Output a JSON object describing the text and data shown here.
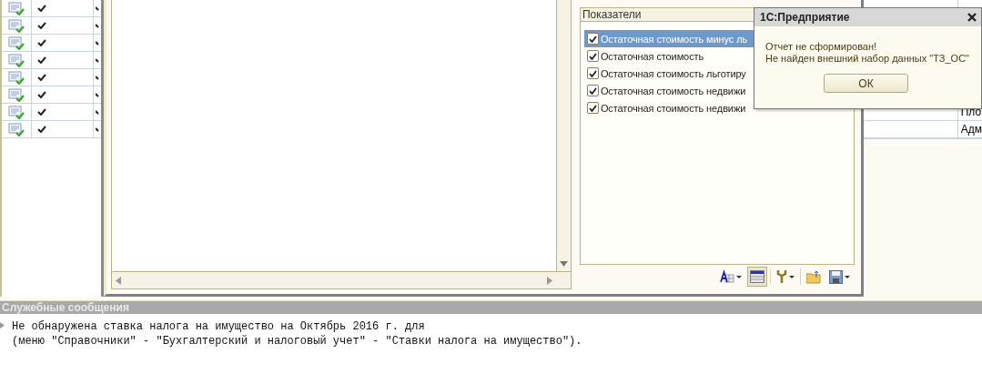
{
  "left_table": {
    "rows": [
      {
        "posted": true,
        "checked": true
      },
      {
        "posted": true,
        "checked": true
      },
      {
        "posted": true,
        "checked": true
      },
      {
        "posted": true,
        "checked": true
      },
      {
        "posted": true,
        "checked": true
      },
      {
        "posted": true,
        "checked": true
      },
      {
        "posted": true,
        "checked": true
      },
      {
        "posted": true,
        "checked": true
      }
    ]
  },
  "panel": {
    "title": "Показатели",
    "items": [
      {
        "label": "Остаточная стоимость минус ль",
        "checked": true,
        "selected": true
      },
      {
        "label": "Остаточная стоимость",
        "checked": true,
        "selected": false
      },
      {
        "label": "Остаточная стоимость льготиру",
        "checked": true,
        "selected": false
      },
      {
        "label": "Остаточная стоимость недвижи",
        "checked": true,
        "selected": false
      },
      {
        "label": "Остаточная стоимость недвижи",
        "checked": true,
        "selected": false
      }
    ]
  },
  "toolbar": [
    {
      "kind": "font",
      "menu": true,
      "pressed": false
    },
    {
      "kind": "table",
      "menu": false,
      "pressed": true
    },
    {
      "kind": "wrench",
      "menu": true,
      "pressed": false
    },
    {
      "kind": "folder",
      "menu": false,
      "pressed": false
    },
    {
      "kind": "save",
      "menu": true,
      "pressed": false
    }
  ],
  "right_table": {
    "rows": [
      {
        "cell": "Пло"
      },
      {
        "cell": "Адм"
      }
    ]
  },
  "dialog": {
    "title": "1С:Предприятие",
    "lines": [
      "Отчет не сформирован!",
      "Не найден внешний набор данных \"ТЗ_ОС\""
    ],
    "button": "ОК"
  },
  "messages": {
    "title": "Служебные сообщения",
    "lines": [
      "Не обнаружена ставка налога на имущество на Октябрь 2016 г. для",
      "(меню \"Справочники\" - \"Бухгалтерский и налоговый учет\" - \"Ставки налога на имущество\")."
    ]
  }
}
